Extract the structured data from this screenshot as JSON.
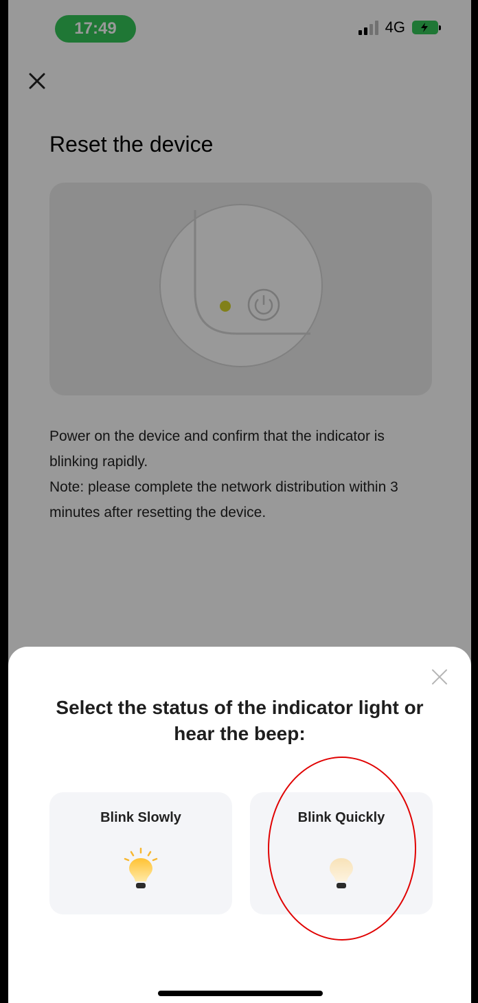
{
  "status_bar": {
    "time": "17:49",
    "network": "4G",
    "colors": {
      "time_pill": "#34c759",
      "battery": "#34c759"
    }
  },
  "background_page": {
    "title": "Reset the device",
    "instructions": [
      "Power on the device and confirm that the indicator is",
      "blinking rapidly.",
      "Note: please complete the network distribution within 3",
      "minutes after resetting the device."
    ],
    "illustration": {
      "indicator_color": "#d8d52a",
      "icon": "power-icon"
    }
  },
  "sheet": {
    "title_lines": [
      "Select the status of the indicator light or",
      "hear the beep:"
    ],
    "options": [
      {
        "label": "Blink Slowly",
        "icon": "lightbulb-on-icon"
      },
      {
        "label": "Blink Quickly",
        "icon": "lightbulb-dim-icon"
      }
    ]
  },
  "annotation": {
    "color": "#e00000"
  }
}
